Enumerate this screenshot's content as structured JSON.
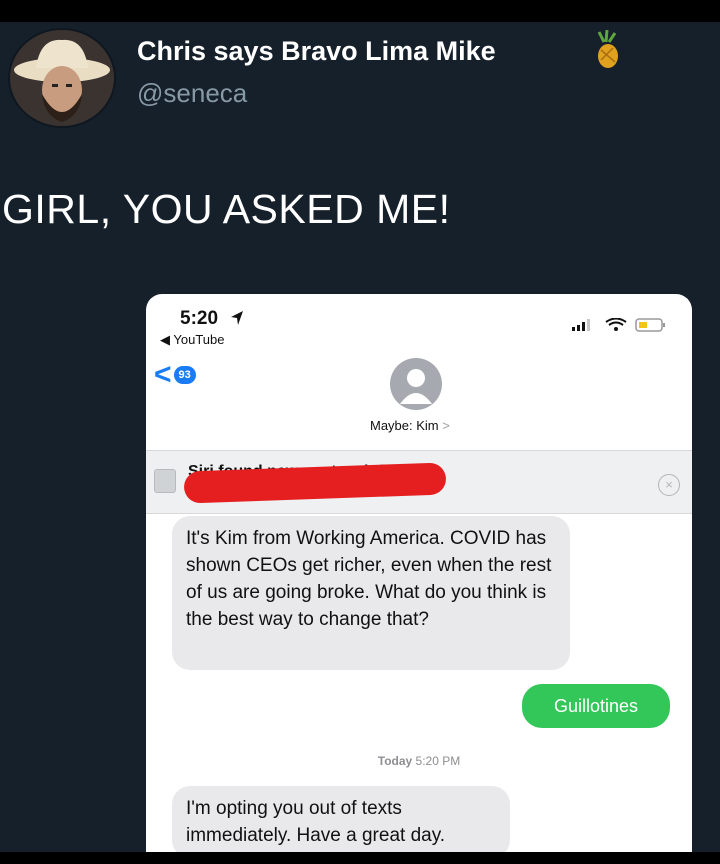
{
  "tweet": {
    "display_name": "Chris says Bravo Lima Mike",
    "handle": "@seneca",
    "text": "GIRL, YOU ASKED ME!"
  },
  "phone": {
    "status": {
      "time": "5:20",
      "back_app": "YouTube"
    },
    "nav": {
      "back_badge": "93",
      "contact_label": "Maybe: Kim",
      "contact_chevron": ">"
    },
    "siri_banner": {
      "text": "Siri found new contact info"
    },
    "messages": [
      {
        "direction": "in",
        "text": "It's Kim from Working America. COVID has shown CEOs get richer, even when the rest of us are going broke. What do you think is the best way to change that?"
      },
      {
        "direction": "out",
        "text": "Guillotines"
      },
      {
        "direction": "in",
        "text": "I'm opting you out of texts immediately. Have a great day."
      }
    ],
    "timestamp": {
      "day": "Today",
      "time": "5:20 PM"
    }
  },
  "colors": {
    "background": "#15202b",
    "imessage_blue": "#1a7cf5",
    "sms_green": "#33c759",
    "redaction_red": "#e51f1f"
  },
  "icons": [
    "avatar-photo",
    "pineapple-icon",
    "location-arrow-icon",
    "signal-icon",
    "wifi-icon",
    "battery-icon",
    "back-chevron-icon",
    "contact-placeholder-icon",
    "contact-card-icon",
    "dismiss-icon"
  ]
}
